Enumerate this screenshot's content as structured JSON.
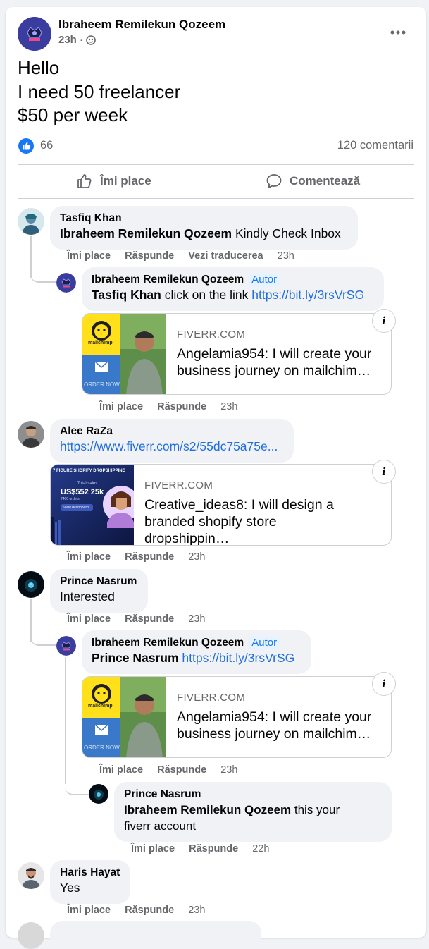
{
  "post": {
    "author": "Ibraheem Remilekun Qozeem",
    "time": "23h",
    "separator": "·",
    "text_lines": [
      "Hello",
      "I need 50 freelancer",
      "$50 per week"
    ],
    "reactions_count": "66",
    "comments_count": "120 comentarii",
    "like_label": "Îmi place",
    "comment_label": "Comentează"
  },
  "labels": {
    "like": "Îmi place",
    "reply": "Răspunde",
    "translate": "Vezi traducerea",
    "author_badge": "Autor"
  },
  "comments": [
    {
      "name": "Tasfiq Khan",
      "mention": "Ibraheem Remilekun Qozeem",
      "text": " Kindly Check Inbox",
      "time": "23h",
      "reply": {
        "name": "Ibraheem Remilekun Qozeem",
        "mention": "Tasfiq Khan",
        "text": " click on the link ",
        "link": "https://bit.ly/3rsVrSG",
        "card_domain": "FIVERR.COM",
        "card_title": "Angelamia954: I will create your business journey on mailchim…",
        "time": "23h"
      }
    },
    {
      "name": "Alee RaZa",
      "link": "https://www.fiverr.com/s2/55dc75a75e...",
      "card_domain": "FIVERR.COM",
      "card_title": "Creative_ideas8: I will design a branded shopify store dropshippin…",
      "card_image_text": [
        "7 FIGURE SHOPIFY DROPSHIPPING",
        "Total sales",
        "US$552 25k",
        "7400 orders",
        "View dashboard"
      ],
      "time": "23h"
    },
    {
      "name": "Prince Nasrum",
      "text": "Interested",
      "time": "23h",
      "reply": {
        "name": "Ibraheem Remilekun Qozeem",
        "mention": "Prince Nasrum",
        "link": "https://bit.ly/3rsVrSG",
        "card_domain": "FIVERR.COM",
        "card_title": "Angelamia954: I will create your business journey on mailchim…",
        "time": "23h"
      },
      "reply2": {
        "name": "Prince Nasrum",
        "mention": "Ibraheem Remilekun Qozeem",
        "text_line1": " this your",
        "text_line2": "fiverr account",
        "time": "22h"
      }
    },
    {
      "name": "Haris Hayat",
      "text": "Yes",
      "time": "23h"
    }
  ],
  "mailchimp_image_text": [
    "mailchimp",
    "ORDER NOW"
  ],
  "colors": {
    "link": "#216fdb",
    "like_blue": "#1877f2",
    "bubble_bg": "#f0f2f5",
    "muted": "#65676b"
  },
  "icons": [
    "more-options-icon",
    "globe-icon",
    "like-reaction-icon",
    "thumbs-up-icon",
    "comment-icon",
    "info-icon"
  ]
}
